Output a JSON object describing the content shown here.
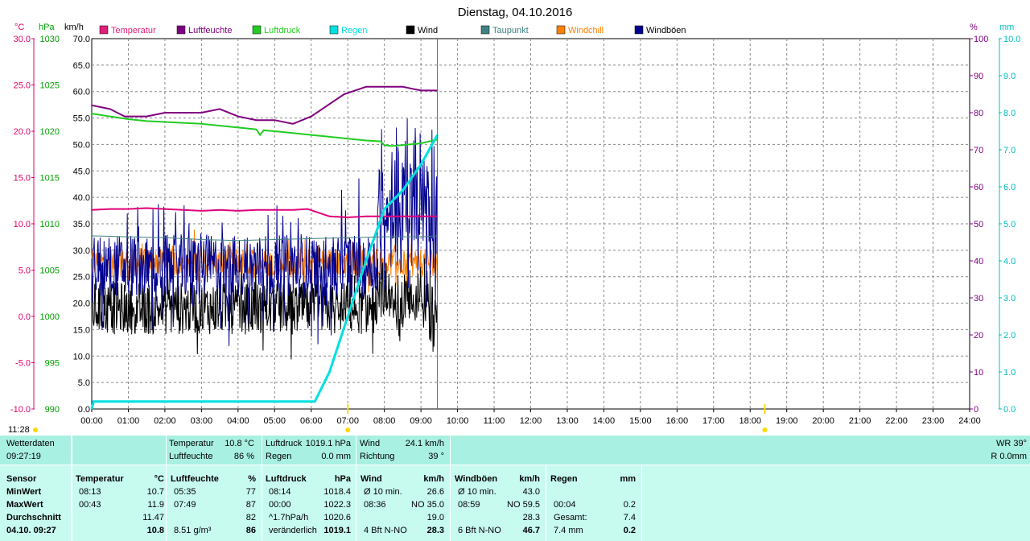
{
  "chart_data": {
    "type": "line",
    "title": "Dienstag, 04.10.2016",
    "unit_labels": {
      "temp": "°C",
      "hpa": "hPa",
      "kmh": "km/h",
      "pct": "%",
      "mm": "mm"
    },
    "axes": {
      "temp": {
        "min": -10,
        "max": 30,
        "ticks": [
          "30.0",
          "25.0",
          "20.0",
          "15.0",
          "10.0",
          "5.0",
          "0.0",
          "-5.0",
          "-10.0"
        ],
        "color": "#e0006a"
      },
      "hpa": {
        "min": 990,
        "max": 1030,
        "ticks": [
          "1030",
          "1025",
          "1020",
          "1015",
          "1010",
          "1005",
          "1000",
          "995",
          "990"
        ],
        "color": "#00a000"
      },
      "kmh": {
        "min": 0,
        "max": 70,
        "ticks": [
          "70.0",
          "65.0",
          "60.0",
          "55.0",
          "50.0",
          "45.0",
          "40.0",
          "35.0",
          "30.0",
          "25.0",
          "20.0",
          "15.0",
          "10.0",
          "5.0",
          "0.0"
        ],
        "color": "#000000"
      },
      "pct": {
        "min": 0,
        "max": 100,
        "ticks": [
          "100",
          "90",
          "80",
          "70",
          "60",
          "50",
          "40",
          "30",
          "20",
          "10",
          "0"
        ],
        "color": "#800080"
      },
      "mm": {
        "min": 0,
        "max": 10,
        "ticks": [
          "10.0",
          "9.0",
          "8.0",
          "7.0",
          "6.0",
          "5.0",
          "4.0",
          "3.0",
          "2.0",
          "1.0",
          "0.0"
        ],
        "color": "#00c0c0"
      }
    },
    "x_ticks": [
      "00:00",
      "01:00",
      "02:00",
      "03:00",
      "04:00",
      "05:00",
      "06:00",
      "07:00",
      "08:00",
      "09:00",
      "10:00",
      "11:00",
      "12:00",
      "13:00",
      "14:00",
      "15:00",
      "16:00",
      "17:00",
      "18:00",
      "19:00",
      "20:00",
      "21:00",
      "22:00",
      "23:00",
      "24:00"
    ],
    "x_range_hours": [
      0,
      24
    ],
    "current_time_hours": 9.45,
    "grid": true,
    "legend_position": "top",
    "legend": [
      {
        "name": "Temperatur",
        "color": "#e0207a"
      },
      {
        "name": "Luftfeuchte",
        "color": "#800080"
      },
      {
        "name": "Luftdruck",
        "color": "#22cc22"
      },
      {
        "name": "Regen",
        "color": "#00e0e0"
      },
      {
        "name": "Wind",
        "color": "#000000"
      },
      {
        "name": "Taupunkt",
        "color": "#408080"
      },
      {
        "name": "Windchill",
        "color": "#ff8000"
      },
      {
        "name": "Windböen",
        "color": "#000090"
      }
    ],
    "series": [
      {
        "name": "Temperatur",
        "axis": "temp",
        "color": "#e0007a",
        "x": [
          0,
          0.5,
          1,
          1.5,
          2,
          2.5,
          3,
          3.5,
          4,
          4.5,
          5,
          5.5,
          5.9,
          6.2,
          6.5,
          7,
          7.5,
          8,
          8.5,
          9,
          9.45
        ],
        "y": [
          11.5,
          11.6,
          11.6,
          11.7,
          11.6,
          11.5,
          11.4,
          11.5,
          11.4,
          11.5,
          11.5,
          11.5,
          11.6,
          11.2,
          10.8,
          10.7,
          10.8,
          10.8,
          10.8,
          10.8,
          10.8
        ]
      },
      {
        "name": "Luftfeuchte",
        "axis": "pct",
        "color": "#800080",
        "x": [
          0,
          0.5,
          0.9,
          1.5,
          2,
          2.5,
          3,
          3.5,
          4,
          4.5,
          5,
          5.5,
          6,
          6.3,
          6.6,
          6.9,
          7.2,
          7.5,
          8,
          8.5,
          9,
          9.45
        ],
        "y": [
          82,
          81,
          79,
          79,
          80,
          80,
          80,
          81,
          79,
          78,
          78,
          77,
          79,
          81,
          83,
          85,
          86,
          87,
          87,
          87,
          86,
          86
        ]
      },
      {
        "name": "Luftdruck",
        "axis": "hpa",
        "color": "#22cc22",
        "x": [
          0,
          0.5,
          1,
          1.5,
          2,
          2.5,
          3,
          3.5,
          4,
          4.5,
          4.6,
          4.7,
          5,
          5.5,
          6,
          6.5,
          7,
          7.5,
          7.9,
          8,
          8.2,
          8.5,
          9,
          9.45
        ],
        "y": [
          1021.9,
          1021.6,
          1021.3,
          1021.1,
          1021.0,
          1020.9,
          1020.8,
          1020.6,
          1020.4,
          1020.2,
          1019.6,
          1020.1,
          1020.0,
          1019.8,
          1019.6,
          1019.4,
          1019.2,
          1019.0,
          1018.9,
          1018.5,
          1018.4,
          1018.5,
          1018.7,
          1019.1
        ]
      },
      {
        "name": "Regen",
        "axis": "mm",
        "color": "#00e0e0",
        "x": [
          0,
          0.05,
          6.1,
          6.5,
          7,
          7.5,
          8,
          8.5,
          9,
          9.45
        ],
        "y": [
          0,
          0.2,
          0.2,
          1.0,
          2.5,
          4.0,
          5.4,
          5.9,
          6.6,
          7.4
        ]
      },
      {
        "name": "Taupunkt",
        "axis": "temp",
        "color": "#408080",
        "x": [
          0,
          1,
          2,
          3,
          4,
          5,
          6,
          7,
          8,
          9,
          9.45
        ],
        "y": [
          8.7,
          8.6,
          8.5,
          8.3,
          8.2,
          8.3,
          8.4,
          8.5,
          8.6,
          8.6,
          8.7
        ]
      }
    ],
    "noisy_series": [
      {
        "name": "Wind",
        "axis": "kmh",
        "color": "#000000",
        "x_start": 0,
        "x_end": 9.45,
        "base": 19,
        "amp": 5,
        "spike": 7
      },
      {
        "name": "Windchill",
        "axis": "temp",
        "color": "#ff8000",
        "x_start": 0,
        "x_end": 9.45,
        "base": 5.8,
        "amp": 1.5,
        "spike": 2.5
      },
      {
        "name": "Windböen",
        "axis": "kmh",
        "color": "#000090",
        "x_start": 0,
        "x_end": 9.45,
        "base": 27,
        "amp": 6,
        "spike": 12
      }
    ],
    "markers": [
      {
        "time": "11:28",
        "hour": 0.0
      },
      {
        "hour": 7.0
      },
      {
        "hour": 18.4
      }
    ]
  },
  "info_row": {
    "wetterdaten": "Wetterdaten",
    "time": "09:27:19",
    "temp_label": "Temperatur",
    "temp_value": "10.8 °C",
    "hum_label": "Luftfeuchte",
    "hum_value": "86 %",
    "press_label": "Luftdruck",
    "press_value": "1019.1 hPa",
    "rain_label": "Regen",
    "rain_value": "0.0 mm",
    "wind_label": "Wind",
    "wind_value": "24.1 km/h",
    "dir_label": "Richtung",
    "dir_value": "39 °",
    "wr": "WR 39°",
    "r": "R 0.0mm"
  },
  "stats": {
    "sensor": [
      "Sensor",
      "MinWert",
      "MaxWert",
      "Durchschnitt",
      "04.10. 09:27"
    ],
    "temperatur": {
      "head": "Temperatur",
      "unit": "°C",
      "rows": [
        [
          "08:13",
          "10.7"
        ],
        [
          "00:43",
          "11.9"
        ],
        [
          "",
          "11.47"
        ],
        [
          "",
          "10.8"
        ]
      ]
    },
    "luftfeuchte": {
      "head": "Luftfeuchte",
      "unit": "%",
      "rows": [
        [
          "05:35",
          "77"
        ],
        [
          "07:49",
          "87"
        ],
        [
          "",
          "82"
        ],
        [
          "8.51 g/m³",
          "86"
        ]
      ]
    },
    "luftdruck": {
      "head": "Luftdruck",
      "unit": "hPa",
      "rows": [
        [
          "08:14",
          "1018.4"
        ],
        [
          "00:00",
          "1022.3"
        ],
        [
          "^1.7hPa/h",
          "1020.6"
        ],
        [
          "veränderlich",
          "1019.1"
        ]
      ]
    },
    "wind": {
      "head": "Wind",
      "unit": "km/h",
      "rows": [
        [
          "Ø 10 min.",
          "26.6"
        ],
        [
          "08:36",
          "NO 35.0"
        ],
        [
          "",
          "19.0"
        ],
        [
          "4 Bft N-NO",
          "28.3"
        ]
      ]
    },
    "windboen": {
      "head": "Windböen",
      "unit": "km/h",
      "rows": [
        [
          "Ø 10 min.",
          "43.0"
        ],
        [
          "08:59",
          "NO 59.5"
        ],
        [
          "",
          "28.3"
        ],
        [
          "6 Bft N-NO",
          "46.7"
        ]
      ]
    },
    "regen": {
      "head": "Regen",
      "unit": "mm",
      "rows": [
        [
          "",
          ""
        ],
        [
          "00:04",
          "0.2"
        ],
        [
          "Gesamt:",
          "7.4"
        ],
        [
          "7.4 mm",
          "0.2"
        ]
      ]
    }
  }
}
